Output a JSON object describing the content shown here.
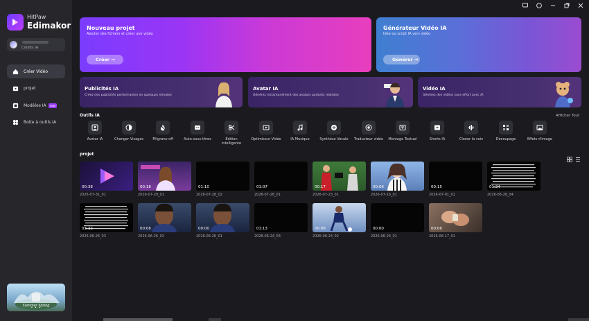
{
  "brand": {
    "top": "HitPaw",
    "name": "Edimakor"
  },
  "credits": {
    "label": "Crédits IA"
  },
  "nav": [
    {
      "label": "Créer Vidéo",
      "icon": "home-icon",
      "active": true
    },
    {
      "label": "projet",
      "icon": "folder-icon",
      "active": false
    },
    {
      "label": "Modèles IA",
      "icon": "template-icon",
      "active": false,
      "badge": "new"
    },
    {
      "label": "Boite à outils IA",
      "icon": "toolbox-icon",
      "active": false
    }
  ],
  "promo": {
    "text": "Summer Spring",
    "dots": "• • •"
  },
  "hero": [
    {
      "title": "Nouveau projet",
      "subtitle": "Ajouter des fichiers et créer une vidéo",
      "button": "Créer →"
    },
    {
      "title": "Générateur Vidéo IA",
      "subtitle": "Idée ou script IA vers vidéo",
      "button": "Générer →"
    }
  ],
  "features": [
    {
      "title": "Publicités IA",
      "subtitle": "Créez des publicités performantes en quelques minutes"
    },
    {
      "title": "Avatar IA",
      "subtitle": "Générez instantanément des avatars parlants réalistes"
    },
    {
      "title": "Vidéo IA",
      "subtitle": "Générez des vidéos sans effort avec AI"
    }
  ],
  "tools_section": {
    "title": "Outils IA",
    "show_all": "Afficher Tout"
  },
  "tools": [
    {
      "label": "Avatar IA",
      "icon": "avatar-icon"
    },
    {
      "label": "Changer Visages",
      "icon": "face-swap-icon"
    },
    {
      "label": "Filigrane off",
      "icon": "watermark-icon"
    },
    {
      "label": "Auto-sous-titres",
      "icon": "subtitle-icon"
    },
    {
      "label": "Édition intelligente",
      "icon": "smart-edit-icon"
    },
    {
      "label": "Optimiseur Vidéo",
      "icon": "enhance-icon"
    },
    {
      "label": "IA Musique",
      "icon": "music-icon"
    },
    {
      "label": "Synthèse Vocale",
      "icon": "tts-icon"
    },
    {
      "label": "Traducteur vidéo",
      "icon": "translate-icon"
    },
    {
      "label": "Montage Textuel",
      "icon": "text-edit-icon"
    },
    {
      "label": "Shorts IA",
      "icon": "shorts-icon"
    },
    {
      "label": "Cloner la voix",
      "icon": "voice-clone-icon"
    },
    {
      "label": "Découpage",
      "icon": "cutout-icon"
    },
    {
      "label": "Effets d'image",
      "icon": "image-effects-icon"
    }
  ],
  "project_section": {
    "title": "projet"
  },
  "videos": [
    {
      "duration": "00:38",
      "name": "2026-07-31_01",
      "thumb": "logo"
    },
    {
      "duration": "00:18",
      "name": "2026-07-29_01",
      "thumb": "studio"
    },
    {
      "duration": "01:10",
      "name": "2026-07-28_02",
      "thumb": "black"
    },
    {
      "duration": "01:07",
      "name": "2026-07-28_01",
      "thumb": "black"
    },
    {
      "duration": "00:17",
      "name": "2026-07-23_01",
      "thumb": "football"
    },
    {
      "duration": "00:06",
      "name": "2026-07-16_01",
      "thumb": "anime"
    },
    {
      "duration": "00:15",
      "name": "2026-07-01_01",
      "thumb": "black"
    },
    {
      "duration": "01:24",
      "name": "2026-06-26_04",
      "thumb": "text"
    },
    {
      "duration": "03:32",
      "name": "2026-06-26_03",
      "thumb": "text"
    },
    {
      "duration": "00:06",
      "name": "2026-06-26_02",
      "thumb": "portrait"
    },
    {
      "duration": "00:00",
      "name": "2026-06-26_01",
      "thumb": "portrait"
    },
    {
      "duration": "01:13",
      "name": "2026-06-24_03",
      "thumb": "black"
    },
    {
      "duration": "00:06",
      "name": "2026-06-24_02",
      "thumb": "player"
    },
    {
      "duration": "00:00",
      "name": "2026-06-24_01",
      "thumb": "black"
    },
    {
      "duration": "00:06",
      "name": "2026-06-17_01",
      "thumb": "hands"
    }
  ],
  "colors": {
    "accent": "#9b3cff",
    "bg": "#1b1b1f",
    "sidebar": "#26262b"
  }
}
